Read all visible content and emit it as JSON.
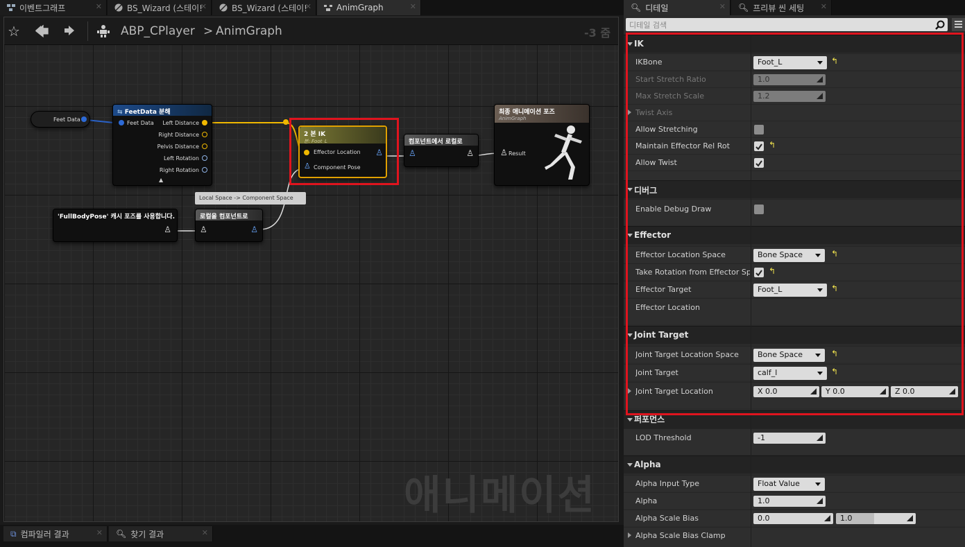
{
  "tabs": [
    {
      "label": "이벤트그래프"
    },
    {
      "label": "BS_Wizard (스테이!"
    },
    {
      "label": "BS_Wizard (스테이!"
    },
    {
      "label": "AnimGraph"
    }
  ],
  "right_tabs": [
    {
      "label": "디테일"
    },
    {
      "label": "프리뷰 씬 세팅"
    }
  ],
  "breadcrumb": {
    "bp": "ABP_CPlayer",
    "sep": ">",
    "graph": "AnimGraph"
  },
  "zoom": "-3 줌",
  "watermark": "애니메이션",
  "search_placeholder": "디테일 검색",
  "nodes": {
    "feetdata_var": "Feet Data",
    "break": {
      "title": "FeetData 분해",
      "in": "Feet Data",
      "outs": [
        "Left Distance",
        "Right Distance",
        "Pelvis Distance",
        "Left Rotation",
        "Right Rotation"
      ]
    },
    "ik": {
      "title": "2 본 IK",
      "sub": "본: Foot_L",
      "pin1": "Effector Location",
      "pin2": "Component Pose"
    },
    "c2l": {
      "title": "컴포넌트에서 로컬로"
    },
    "final": {
      "title": "최종 애니메이션 포즈",
      "sub": "AnimGraph",
      "pin": "Result"
    },
    "cache": {
      "title": "'FullBodyPose' 캐시 포즈를 사용합니다."
    },
    "l2c": {
      "title": "로컬을 컴포넌트로",
      "tooltip": "Local Space -> Component Space"
    }
  },
  "details": {
    "ik": {
      "title": "IK",
      "ikbone": "IKBone",
      "ikbone_val": "Foot_L",
      "start_stretch": "Start Stretch Ratio",
      "start_stretch_val": "1.0",
      "max_stretch": "Max Stretch Scale",
      "max_stretch_val": "1.2",
      "twist_axis": "Twist Axis",
      "allow_stretching": "Allow Stretching",
      "maintain": "Maintain Effector Rel Rot",
      "allow_twist": "Allow Twist"
    },
    "debug": {
      "title": "디버그",
      "enable": "Enable Debug Draw"
    },
    "effector": {
      "title": "Effector",
      "loc_space": "Effector Location Space",
      "loc_space_val": "Bone Space",
      "take_rot": "Take Rotation from Effector Spac",
      "target": "Effector Target",
      "target_val": "Foot_L",
      "location": "Effector Location"
    },
    "joint": {
      "title": "Joint Target",
      "loc_space": "Joint Target Location Space",
      "loc_space_val": "Bone Space",
      "target": "Joint Target",
      "target_val": "calf_l",
      "location": "Joint Target Location",
      "x": "X  0.0",
      "y": "Y  0.0",
      "z": "Z  0.0"
    },
    "perf": {
      "title": "퍼포먼스",
      "lod": "LOD Threshold",
      "lod_val": "-1"
    },
    "alpha": {
      "title": "Alpha",
      "input_type": "Alpha Input Type",
      "input_type_val": "Float Value",
      "alpha": "Alpha",
      "alpha_val": "1.0",
      "scale_bias": "Alpha Scale Bias",
      "bias_a": "0.0",
      "bias_b": "1.0",
      "clamp": "Alpha Scale Bias Clamp"
    }
  },
  "bottom_tabs": [
    {
      "label": "컴파일러 결과"
    },
    {
      "label": "찾기 결과"
    }
  ]
}
